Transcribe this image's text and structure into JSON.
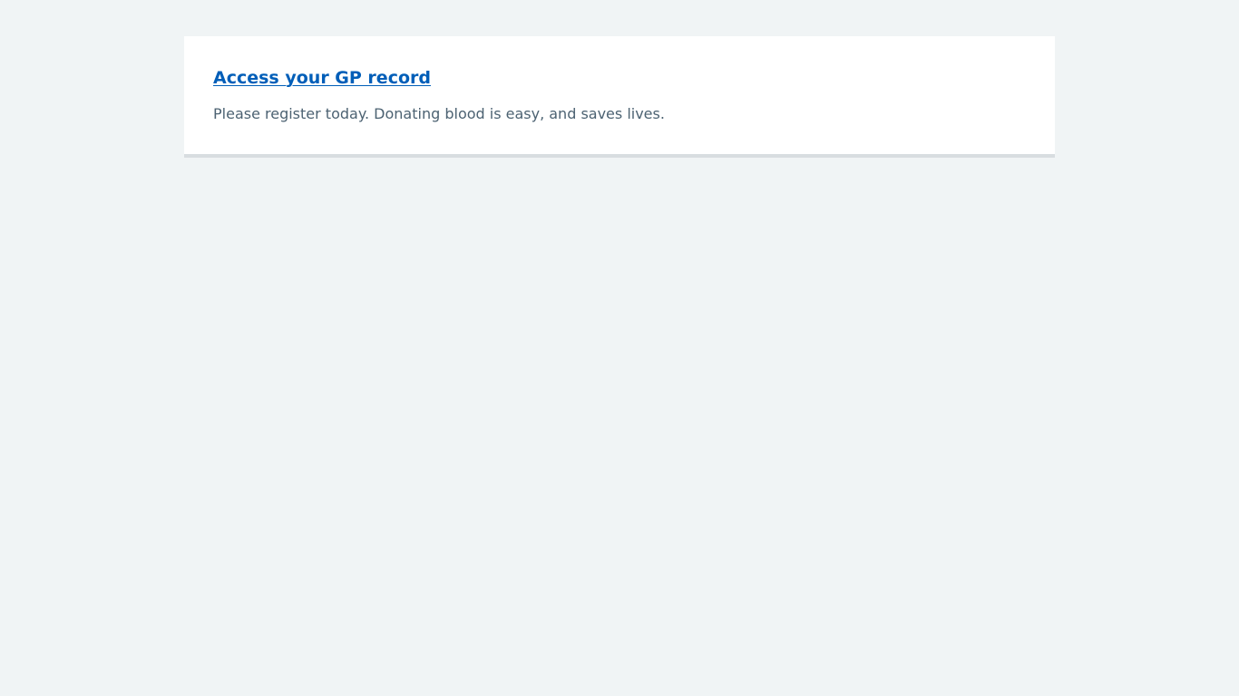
{
  "card": {
    "heading_link": "Access your GP record",
    "description": "Please register today. Donating blood is easy, and saves lives."
  },
  "colors": {
    "page_background": "#f0f4f5",
    "card_background": "#ffffff",
    "link": "#005eb8",
    "secondary_text": "#4c6272",
    "card_border": "#d8dde0"
  }
}
